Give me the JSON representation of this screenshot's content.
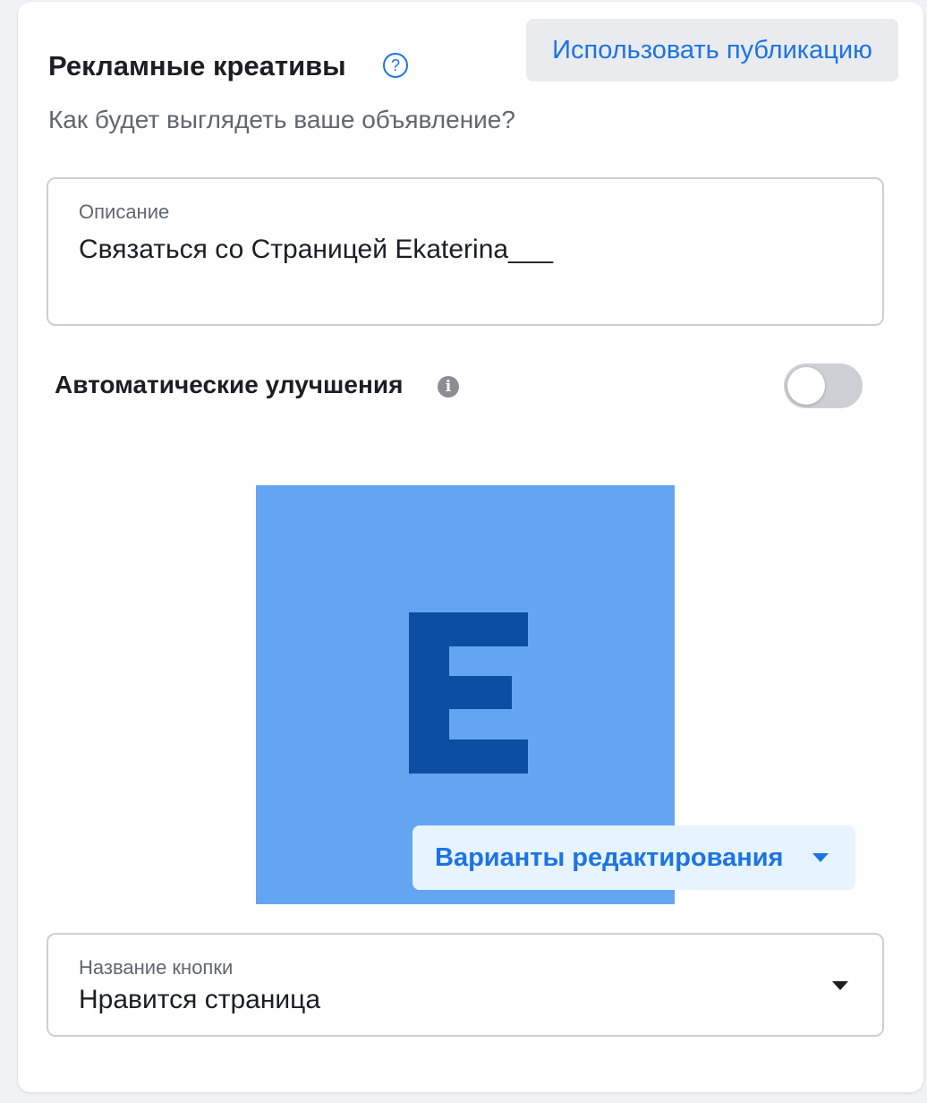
{
  "section": {
    "title": "Рекламные креативы",
    "subtitle": "Как будет выглядеть ваше объявление?",
    "use_post_label": "Использовать публикацию"
  },
  "description": {
    "label": "Описание",
    "value": "Связаться со Страницей Ekaterina___"
  },
  "auto_enhancements": {
    "label": "Автоматические улучшения",
    "enabled": false
  },
  "image": {
    "letter": "E",
    "background_color": "#64a5f2",
    "letter_color": "#0b4ea2"
  },
  "edit_options": {
    "label": "Варианты редактирования"
  },
  "button_name": {
    "label": "Название кнопки",
    "value": "Нравится страница"
  },
  "colors": {
    "accent": "#1b74e4",
    "toggle_off": "#ccd0d5"
  }
}
